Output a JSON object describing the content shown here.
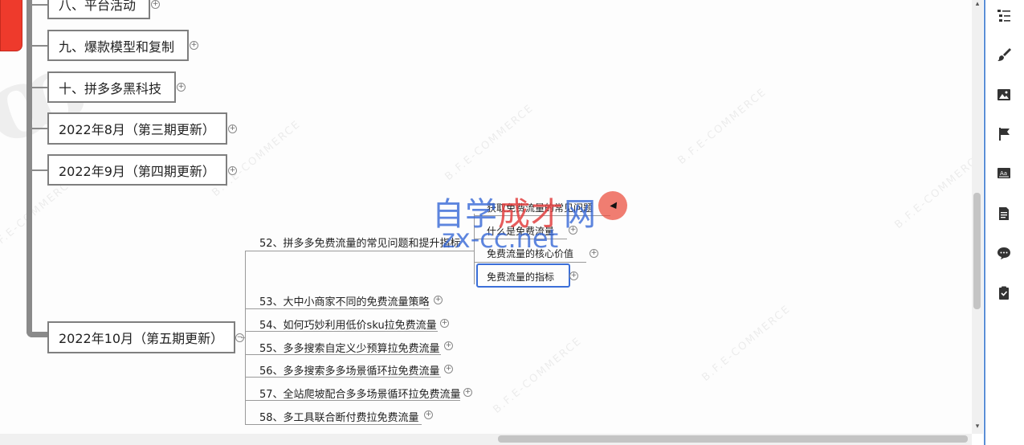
{
  "mindmap": {
    "branches": [
      {
        "label": "八、平台活动"
      },
      {
        "label": "九、爆款模型和复制"
      },
      {
        "label": "十、拼多多黑科技"
      },
      {
        "label": "2022年8月（第三期更新）"
      },
      {
        "label": "2022年9月（第四期更新）"
      },
      {
        "label": "2022年10月（第五期更新）"
      }
    ],
    "subtopics": [
      {
        "label": "52、拼多多免费流量的常见问题和提升指标"
      },
      {
        "label": "53、大中小商家不同的免费流量策略"
      },
      {
        "label": "54、如何巧妙利用低价sku拉免费流量"
      },
      {
        "label": "55、多多搜索自定义少预算拉免费流量"
      },
      {
        "label": "56、多多搜索多多场景循环拉免费流量"
      },
      {
        "label": "57、全站爬坡配合多多场景循环拉免费流量"
      },
      {
        "label": "58、多工具联合断付费拉免费流量"
      }
    ],
    "leaves": [
      {
        "label": "获取免费流量的常见问题"
      },
      {
        "label": "什么是免费流量"
      },
      {
        "label": "免费流量的核心价值"
      },
      {
        "label": "免费流量的指标"
      }
    ],
    "expand_symbol": "+",
    "collapse_symbol": "−"
  },
  "overlay": {
    "brand_part1": "自学",
    "brand_part2": "成才",
    "brand_part3": "网",
    "url": "zx-cc.net"
  },
  "watermark": {
    "text": "B.F.E-COMMERCE"
  },
  "sidebar": {
    "tools": [
      {
        "icon": "outline-icon"
      },
      {
        "icon": "brush-icon"
      },
      {
        "icon": "image-icon"
      },
      {
        "icon": "flag-icon"
      },
      {
        "icon": "text-style-icon"
      },
      {
        "icon": "note-icon"
      },
      {
        "icon": "comment-icon"
      },
      {
        "icon": "task-icon"
      }
    ],
    "accent": "#5b8fd6"
  }
}
